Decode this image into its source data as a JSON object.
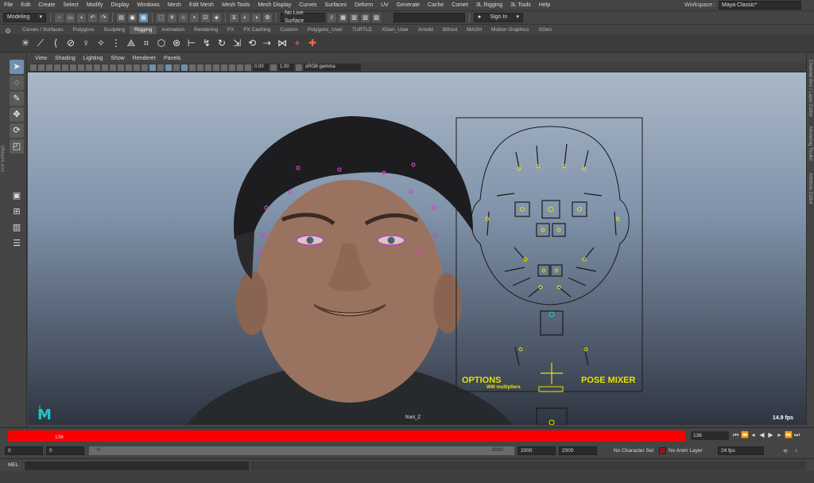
{
  "menu": {
    "items": [
      "File",
      "Edit",
      "Create",
      "Select",
      "Modify",
      "Display",
      "Windows",
      "Mesh",
      "Edit Mesh",
      "Mesh Tools",
      "Mesh Display",
      "Curves",
      "Surfaces",
      "Deform",
      "UV",
      "Generate",
      "Cache",
      "Comet",
      "3L Rigging",
      "3L Tools",
      "Help"
    ],
    "workspace_label": "Workspace :",
    "workspace_value": "Maya Classic*"
  },
  "statusline": {
    "mode": "Modeling",
    "live_surface": "No Live Surface",
    "sign_in": "Sign In"
  },
  "shelf": {
    "tabs": [
      "Curves / Surfaces",
      "Polygons",
      "Sculpting",
      "Rigging",
      "Animation",
      "Rendering",
      "FX",
      "FX Caching",
      "Custom",
      "Polygons_User",
      "TURTLE",
      "XGen_User",
      "Arnold",
      "Bifrost",
      "MASH",
      "Motion Graphics",
      "XGen"
    ],
    "active_tab": "Rigging"
  },
  "toolbox": {
    "side_label": "Tool Settings"
  },
  "right_strip": {
    "labels": [
      "Channel Box / Layer Editor",
      "Modeling Toolkit",
      "Attribute Editor"
    ]
  },
  "panel": {
    "menu": [
      "View",
      "Shading",
      "Lighting",
      "Show",
      "Renderer",
      "Panels"
    ],
    "exposure": "0.00",
    "gamma": "1.00",
    "color_space": "sRGB gamma",
    "camera": "front_Z",
    "fps": "14.9 fps"
  },
  "face_ui": {
    "options": "OPTIONS",
    "multipliers": "WM multipliers",
    "pose_mixer": "POSE MIXER"
  },
  "timeslider": {
    "frame_label": "136",
    "current_frame": "136"
  },
  "range": {
    "start": "0",
    "anim_start": "0",
    "slider_start": "0",
    "slider_end": "2000",
    "anim_end": "2000",
    "end": "2000",
    "character_set": "No Character Set",
    "anim_layer": "No Anim Layer",
    "fps": "24 fps"
  },
  "cmdline": {
    "label": "MEL"
  },
  "colors": {
    "timeslider_range": "#fb0000",
    "face_ui_text": "#e8e200",
    "maya_logo": "#19c8c8",
    "select_highlight": "#6e8fb0"
  }
}
